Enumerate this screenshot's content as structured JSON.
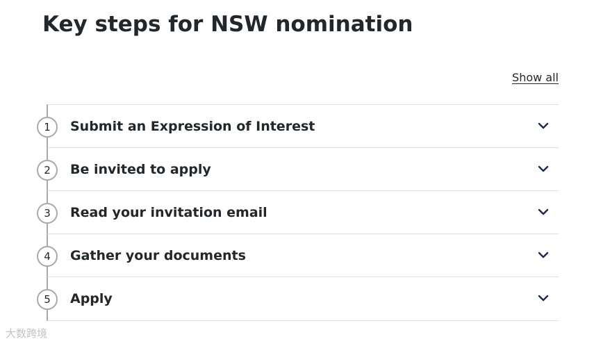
{
  "page": {
    "title": "Key steps for NSW nomination",
    "show_all_label": "Show all"
  },
  "steps": [
    {
      "number": "1",
      "label": "Submit an Expression of Interest"
    },
    {
      "number": "2",
      "label": "Be invited to apply"
    },
    {
      "number": "3",
      "label": "Read your invitation email"
    },
    {
      "number": "4",
      "label": "Gather your documents"
    },
    {
      "number": "5",
      "label": "Apply"
    }
  ],
  "icons": {
    "step_toggle": "chevron-down-icon"
  },
  "colors": {
    "text": "#22272b",
    "chevron": "#1a2b49",
    "timeline": "#a7a9ad",
    "divider": "#dedede"
  },
  "watermark": {
    "text": "大数跨境"
  }
}
